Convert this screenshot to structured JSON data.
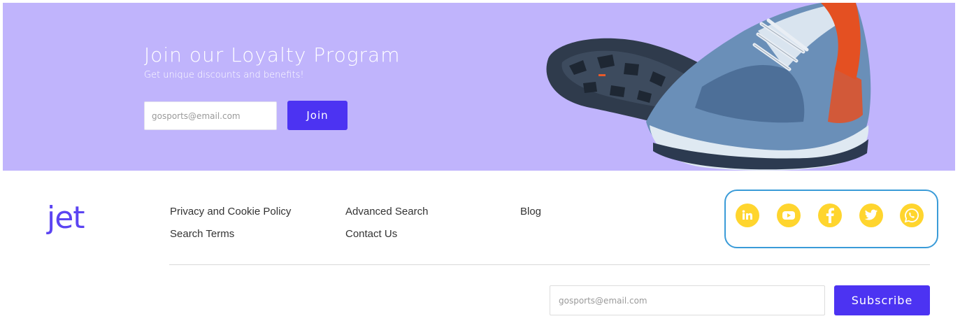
{
  "banner": {
    "title": "Join our Loyalty Program",
    "subtitle": "Get unique discounts and benefits!",
    "email_placeholder": "gosports@email.com",
    "join_label": "Join",
    "image": "running-shoe"
  },
  "footer": {
    "logo": "jet",
    "links": {
      "privacy": "Privacy and Cookie Policy",
      "search_terms": "Search Terms",
      "advanced_search": "Advanced Search",
      "contact": "Contact Us",
      "blog": "Blog"
    },
    "social": [
      "linkedin-icon",
      "youtube-icon",
      "facebook-icon",
      "twitter-icon",
      "whatsapp-icon"
    ],
    "subscribe_placeholder": "gosports@email.com",
    "subscribe_label": "Subscribe"
  },
  "colors": {
    "banner_bg": "#c0b4fc",
    "accent": "#4c33f2",
    "social_icon": "#ffd52e",
    "social_border": "#3a9bd8"
  }
}
